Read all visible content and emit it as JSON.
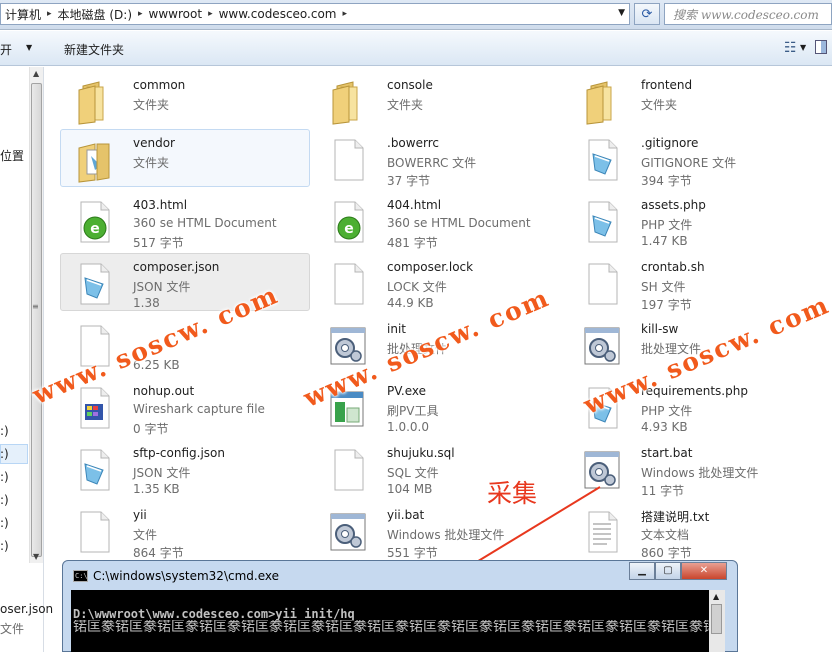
{
  "address_bar": {
    "crumbs": [
      "计算机",
      "本地磁盘 (D:)",
      "wwwroot",
      "www.codesceo.com"
    ],
    "search_placeholder": "搜索 www.codesceo.com"
  },
  "toolbar": {
    "open_label": "打开",
    "new_folder_label": "新建文件夹"
  },
  "nav_pane": {
    "fragments": [
      "位置",
      ":)",
      ":)",
      ":)",
      ":)",
      ":)",
      ":)"
    ],
    "bottom_name": "oser.json",
    "bottom_type": "文件"
  },
  "files": [
    {
      "name": "common",
      "type": "文件夹",
      "size": "",
      "icon": "folder-icon"
    },
    {
      "name": "console",
      "type": "文件夹",
      "size": "",
      "icon": "folder-icon"
    },
    {
      "name": "frontend",
      "type": "文件夹",
      "size": "",
      "icon": "folder-icon"
    },
    {
      "name": "vendor",
      "type": "文件夹",
      "size": "",
      "icon": "folder-doc-icon"
    },
    {
      "name": ".bowerrc",
      "type": "BOWERRC 文件",
      "size": "37 字节",
      "icon": "blank-file-icon"
    },
    {
      "name": ".gitignore",
      "type": "GITIGNORE 文件",
      "size": "394 字节",
      "icon": "text-file-icon"
    },
    {
      "name": "403.html",
      "type": "360 se HTML Document",
      "size": "517 字节",
      "icon": "html-file-icon"
    },
    {
      "name": "404.html",
      "type": "360 se HTML Document",
      "size": "481 字节",
      "icon": "html-file-icon"
    },
    {
      "name": "assets.php",
      "type": "PHP 文件",
      "size": "1.47 KB",
      "icon": "text-file-icon"
    },
    {
      "name": "composer.json",
      "type": "JSON 文件",
      "size": "1.38",
      "icon": "text-file-icon"
    },
    {
      "name": "composer.lock",
      "type": "LOCK 文件",
      "size": "44.9 KB",
      "icon": "blank-file-icon"
    },
    {
      "name": "crontab.sh",
      "type": "SH 文件",
      "size": "197 字节",
      "icon": "blank-file-icon"
    },
    {
      "name": "",
      "type": "",
      "size": "6.25 KB",
      "icon": "blank-file-icon"
    },
    {
      "name": "init",
      "type": "批处理文件",
      "size": "",
      "icon": "batch-file-icon"
    },
    {
      "name": "kill-sw",
      "type": "批处理文件",
      "size": "",
      "icon": "batch-file-icon"
    },
    {
      "name": "nohup.out",
      "type": "Wireshark capture file",
      "size": "0 字节",
      "icon": "wireshark-file-icon"
    },
    {
      "name": "PV.exe",
      "type": "刷PV工具",
      "size": "1.0.0.0",
      "icon": "exe-file-icon"
    },
    {
      "name": "requirements.php",
      "type": "PHP 文件",
      "size": "4.93 KB",
      "icon": "text-file-icon"
    },
    {
      "name": "sftp-config.json",
      "type": "JSON 文件",
      "size": "1.35 KB",
      "icon": "text-file-icon"
    },
    {
      "name": "shujuku.sql",
      "type": "SQL 文件",
      "size": "104 MB",
      "icon": "blank-file-icon"
    },
    {
      "name": "start.bat",
      "type": "Windows 批处理文件",
      "size": "11 字节",
      "icon": "batch-file-icon"
    },
    {
      "name": "yii",
      "type": "文件",
      "size": "864 字节",
      "icon": "blank-file-icon"
    },
    {
      "name": "yii.bat",
      "type": "Windows 批处理文件",
      "size": "551 字节",
      "icon": "batch-file-icon"
    },
    {
      "name": "搭建说明.txt",
      "type": "文本文档",
      "size": "860 字节",
      "icon": "txt-file-icon"
    }
  ],
  "watermark": "www. soscw. com",
  "annotation": "采集",
  "cmd": {
    "title": "C:\\windows\\system32\\cmd.exe",
    "command": "D:\\wwwroot\\www.codesceo.com>yii init/hq",
    "garbled_output": "锘匡豢锘匡豢锘匡豢锘匡豢锘匡豢锘匡豢锘匡豢锘匡豢锘匡豢锘匡豢锘匡豢锘匡豢锘匡豢锘匡豢锘匡豢锘匡豢锘匡豢锘匡豢锘匡豢锘匡豢锘匡豢锘匡豢锘匡豢锘匡豢锘匡豢锘匡豢锘匡豢锘匡豢锘匡豢锘匡豢锘匡豢锘匡豢锘匡豢锘匡豢锘匡豢锘匡豢锘匡豢锘匡豢锘匡豢锘匡豢锘匡豢锘匡豢锘匡豢锘匡豢锘匡豢锘匡豢锘匡豢锘匡豢锘匡豢锘匡豢锘匡豢锘匡豢锘匡豢锘匡豢锘匡豢锘匡豢锘匡豢锘匡豢锘匡豢锘匡豢锘匡豢锘匡豢锘匡豢锘匡豢锘匡豢锘匡豢锘匡豢锘匡豢锘匡豢锘匡豢锘匡豢锘匡豢锘匡豢锘匡豢锘匡豢锘匡豢锘匡豢锘匡豢锘匡豢锘匡豢锘匡豢锘匡豢锘匡豢锘匡豢锘匡豢"
  },
  "colors": {
    "watermark": "#f15a1c",
    "annotation": "#e8381e",
    "selection": "#c4daf2"
  }
}
